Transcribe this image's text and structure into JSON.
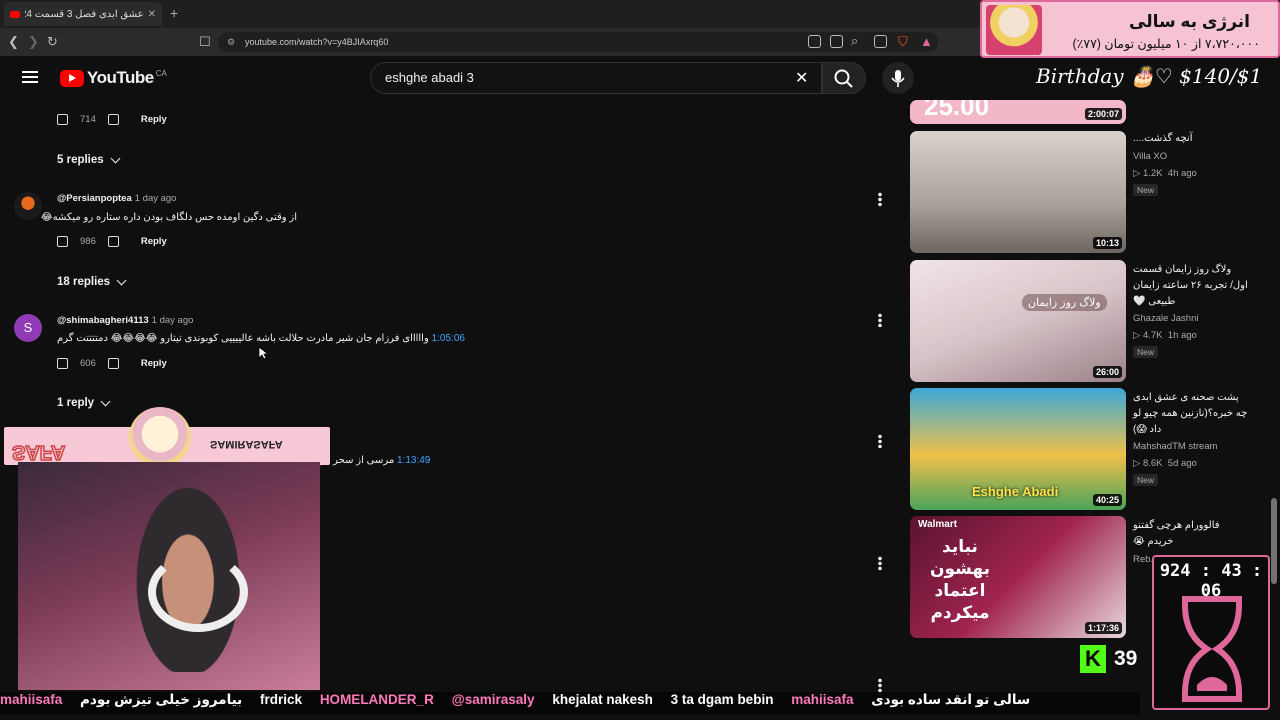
{
  "browser": {
    "tab_title": "عشق ابدی فصل 3 قسمت 24 - be",
    "url": "youtube.com/watch?v=y4BJIAxrq60"
  },
  "youtube": {
    "logo_text": "YouTube",
    "country": "CA",
    "search_value": "eshghe abadi 3"
  },
  "comments": [
    {
      "likes": "714",
      "reply_label": "Reply",
      "replies_label": "5 replies"
    },
    {
      "author": "@Persianpoptea",
      "time": "1 day ago",
      "text": "از وقتی دگین اومده حس دلگاف بودن داره ستاره رو میکشه😂",
      "likes": "986",
      "reply_label": "Reply",
      "replies_label": "18 replies"
    },
    {
      "author": "@shimabagheri4113",
      "time": "1 day ago",
      "avatar_letter": "S",
      "timestamp": "1:05:06",
      "text": "وااااای فرزام جان شیر مادرت حلالت باشه عالییییی کوبوندی تیتارو 😂😂😂😂 دمتتتتت گرم",
      "likes": "606",
      "reply_label": "Reply",
      "replies_label": "1 reply"
    },
    {
      "timestamp": "1:13:49",
      "text": "مرسی از سحر قریشی"
    }
  ],
  "sidebar": {
    "top_partial_text": "25.00",
    "top_partial_duration": "2:00:07",
    "videos": [
      {
        "title": "آنچه گذشت....",
        "channel": "Villa XO",
        "views": "1.2K",
        "ago": "4h ago",
        "badge": "New",
        "duration": "10:13"
      },
      {
        "title": "ولاگ روز زایمان قسمت اول/ تجربه ۲۶ ساعته زایمان طبیعی 🤍",
        "channel": "Ghazale Jashni",
        "views": "4.7K",
        "ago": "1h ago",
        "badge": "New",
        "duration": "26:00",
        "thumb_text": "ولاگ روز زایمان"
      },
      {
        "title": "پشت صحنه ی عشق ابدی چه خبره؟(نازنین همه چیو لو داد 😱)",
        "channel": "MahshadTM stream",
        "views": "8.6K",
        "ago": "5d ago",
        "badge": "New",
        "duration": "40:25",
        "thumb_text": "Eshghe Abadi"
      },
      {
        "title": "فالوورام هرچی گفتنو خریدم 😭",
        "channel": "Reb...",
        "duration": "1:17:36",
        "thumb_brand": "Walmart",
        "thumb_text": "نباید بهشون اعتماد میکردم"
      }
    ]
  },
  "overlays": {
    "ad_line1": "انرژی به سالی",
    "ad_line2": "۷،۷۲۰،۰۰۰ از ۱۰ میلیون تومان (۷۷٪)",
    "ad_progress_percent": 77,
    "birthday_text": "Birthday 🎂♡ $1​40/$1",
    "timer": "924 : 43 : 06",
    "kick_count": "39",
    "streamer_tag": "SAMIRASAFA",
    "ticker": [
      "mahiisafa",
      "بیامروز خیلی تیزش بودم",
      "frdrick",
      "HOMELANDER_R",
      "@samirasaly",
      "khejalat nakesh",
      "3 ta dgam bebin",
      "mahiisafa",
      "سالی تو انقد ساده بودی"
    ]
  },
  "colors": {
    "accent_pink": "#e0679a",
    "link_blue": "#3ea6ff",
    "yt_red": "#ff0000",
    "kick_green": "#53fc18"
  }
}
